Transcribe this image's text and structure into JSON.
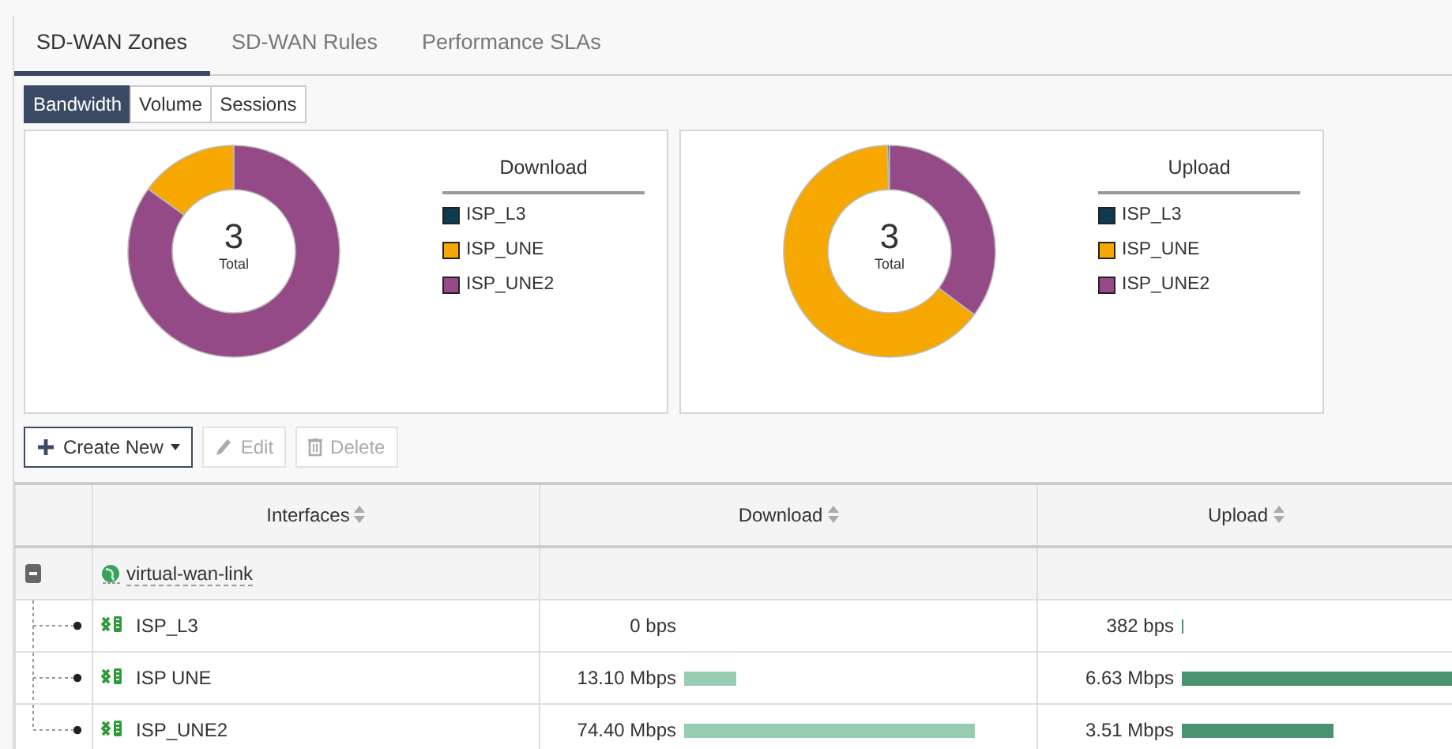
{
  "tabs": [
    {
      "label": "SD-WAN Zones",
      "selected": true
    },
    {
      "label": "SD-WAN Rules",
      "selected": false
    },
    {
      "label": "Performance SLAs",
      "selected": false
    }
  ],
  "view_toggle": [
    {
      "label": "Bandwidth",
      "selected": true
    },
    {
      "label": "Volume",
      "selected": false
    },
    {
      "label": "Sessions",
      "selected": false
    }
  ],
  "charts": [
    {
      "center_value": "3",
      "center_label": "Total",
      "legend_title": "Download",
      "legend": [
        {
          "label": "ISP_L3",
          "color": "#0e3a52"
        },
        {
          "label": "ISP_UNE",
          "color": "#f7a800"
        },
        {
          "label": "ISP_UNE2",
          "color": "#954a88"
        }
      ]
    },
    {
      "center_value": "3",
      "center_label": "Total",
      "legend_title": "Upload",
      "legend": [
        {
          "label": "ISP_L3",
          "color": "#0e3a52"
        },
        {
          "label": "ISP_UNE",
          "color": "#f7a800"
        },
        {
          "label": "ISP_UNE2",
          "color": "#954a88"
        }
      ]
    }
  ],
  "toolbar": [
    {
      "kind": "create",
      "label": "Create New",
      "disabled": false
    },
    {
      "kind": "edit",
      "label": "Edit",
      "disabled": true
    },
    {
      "kind": "delete",
      "label": "Delete",
      "disabled": true
    }
  ],
  "table": {
    "columns": [
      {
        "label": "Interfaces",
        "sortable": true
      },
      {
        "label": "Download",
        "sortable": true
      },
      {
        "label": "Upload",
        "sortable": true
      }
    ],
    "rows": [
      {
        "name": "virtual-wan-link",
        "expanded": true,
        "children": [
          {
            "name": "ISP_L3",
            "download": {
              "text": "0 bps"
            },
            "upload": {
              "text": "382 bps"
            }
          },
          {
            "name": "ISP UNE",
            "download": {
              "text": "13.10 Mbps"
            },
            "upload": {
              "text": "6.63 Mbps"
            }
          },
          {
            "name": "ISP_UNE2",
            "download": {
              "text": "74.40 Mbps"
            },
            "upload": {
              "text": "3.51 Mbps"
            }
          }
        ]
      }
    ]
  }
}
